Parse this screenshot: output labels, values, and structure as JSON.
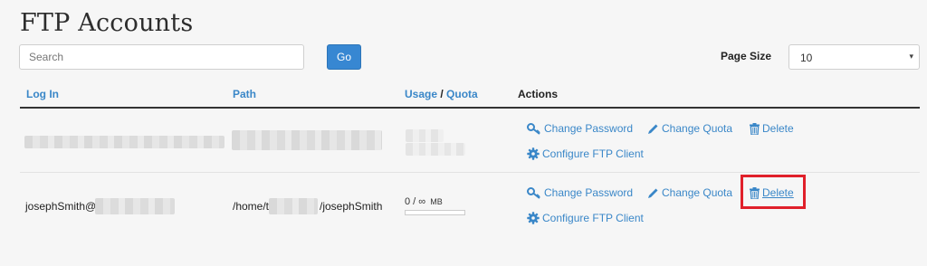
{
  "page": {
    "title": "FTP Accounts"
  },
  "search": {
    "placeholder": "Search",
    "value": "",
    "go_label": "Go"
  },
  "page_size": {
    "label": "Page Size",
    "selected": "10",
    "caret": "▾"
  },
  "columns": {
    "login": "Log In",
    "path": "Path",
    "usage": "Usage",
    "slash": " / ",
    "quota": "Quota",
    "actions": "Actions"
  },
  "rows": [
    {
      "login": "",
      "path": "",
      "usage": "",
      "actions": {
        "change_password": "Change Password",
        "change_quota": "Change Quota",
        "delete": "Delete",
        "configure": "Configure FTP Client"
      }
    },
    {
      "login_prefix": "josephSmith@",
      "path_prefix": "/home/t",
      "path_suffix": "/josephSmith",
      "usage": "0 / ∞",
      "usage_unit": "MB",
      "usage_fraction": 0,
      "actions": {
        "change_password": "Change Password",
        "change_quota": "Change Quota",
        "delete": "Delete",
        "configure": "Configure FTP Client"
      }
    }
  ],
  "colors": {
    "accent": "#3787d2",
    "link": "#3a87c8",
    "highlight": "#e0202a"
  },
  "icons": {
    "password": "key-icon",
    "quota": "pencil-icon",
    "delete": "trash-icon",
    "configure": "gear-icon"
  }
}
